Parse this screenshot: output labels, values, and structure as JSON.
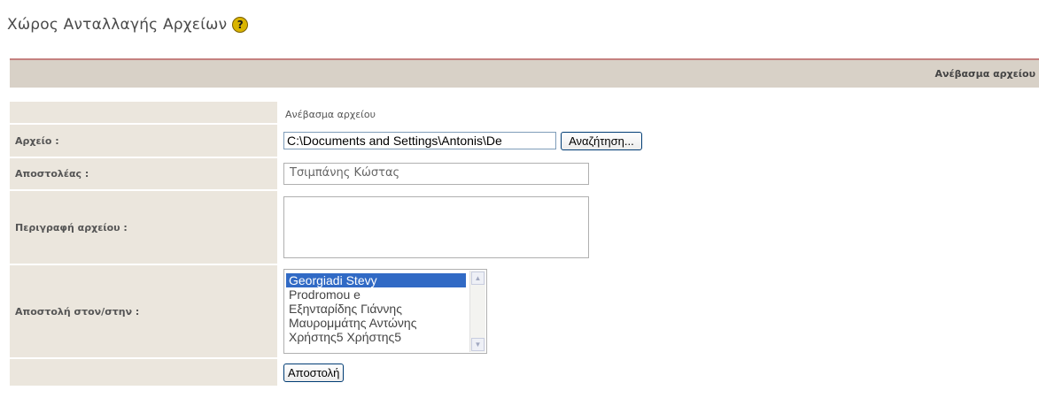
{
  "page": {
    "title": "Χώρος Ανταλλαγής Αρχείων",
    "help_icon": "?"
  },
  "header": {
    "label": "Ανέβασμα αρχείου"
  },
  "form": {
    "section_label": "Ανέβασμα αρχείου",
    "file": {
      "label": "Αρχείο :",
      "value": "C:\\Documents and Settings\\Antonis\\De",
      "browse_label": "Αναζήτηση..."
    },
    "sender": {
      "label": "Αποστολέας :",
      "value": "Τσιμπάνης Κώστας"
    },
    "description": {
      "label": "Περιγραφή αρχείου :",
      "value": ""
    },
    "recipients": {
      "label": "Αποστολή στον/στην :",
      "options": [
        "Georgiadi Stevy",
        "Prodromou e",
        "Εξηνταρίδης Γιάννης",
        "Μαυρομμάτης Αντώνης",
        "Χρήστης5 Χρήστης5"
      ],
      "selected": "Georgiadi Stevy"
    },
    "submit_label": "Αποστολή"
  },
  "colors": {
    "header_bar": "#d8d1c7",
    "header_border": "#c4807f",
    "label_cell": "#ebe6dd",
    "selection": "#316ac5"
  }
}
